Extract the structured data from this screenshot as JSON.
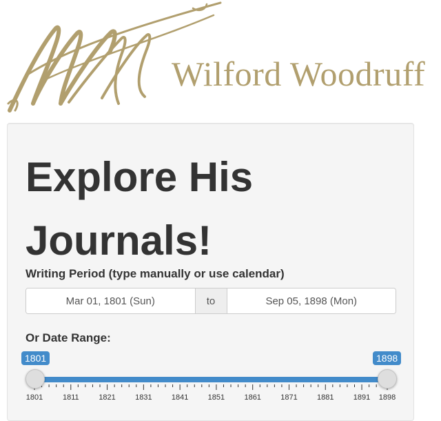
{
  "header": {
    "brand_name": "Wilford Woodruff",
    "logo_icon": "signature-monogram-icon",
    "brand_color": "#b19f6e"
  },
  "main": {
    "title": "Explore His Journals!",
    "writing_period": {
      "label": "Writing Period (type manually or use calendar)",
      "start_value": "Mar 01, 1801 (Sun)",
      "separator": "to",
      "end_value": "Sep 05, 1898 (Mon)"
    },
    "date_range": {
      "label": "Or Date Range:",
      "min": 1801,
      "max": 1898,
      "from": "1801",
      "to": "1898",
      "tick_labels": [
        "1801",
        "1811",
        "1821",
        "1831",
        "1841",
        "1851",
        "1861",
        "1871",
        "1881",
        "1891",
        "1898"
      ],
      "accent_color": "#428bca"
    }
  }
}
